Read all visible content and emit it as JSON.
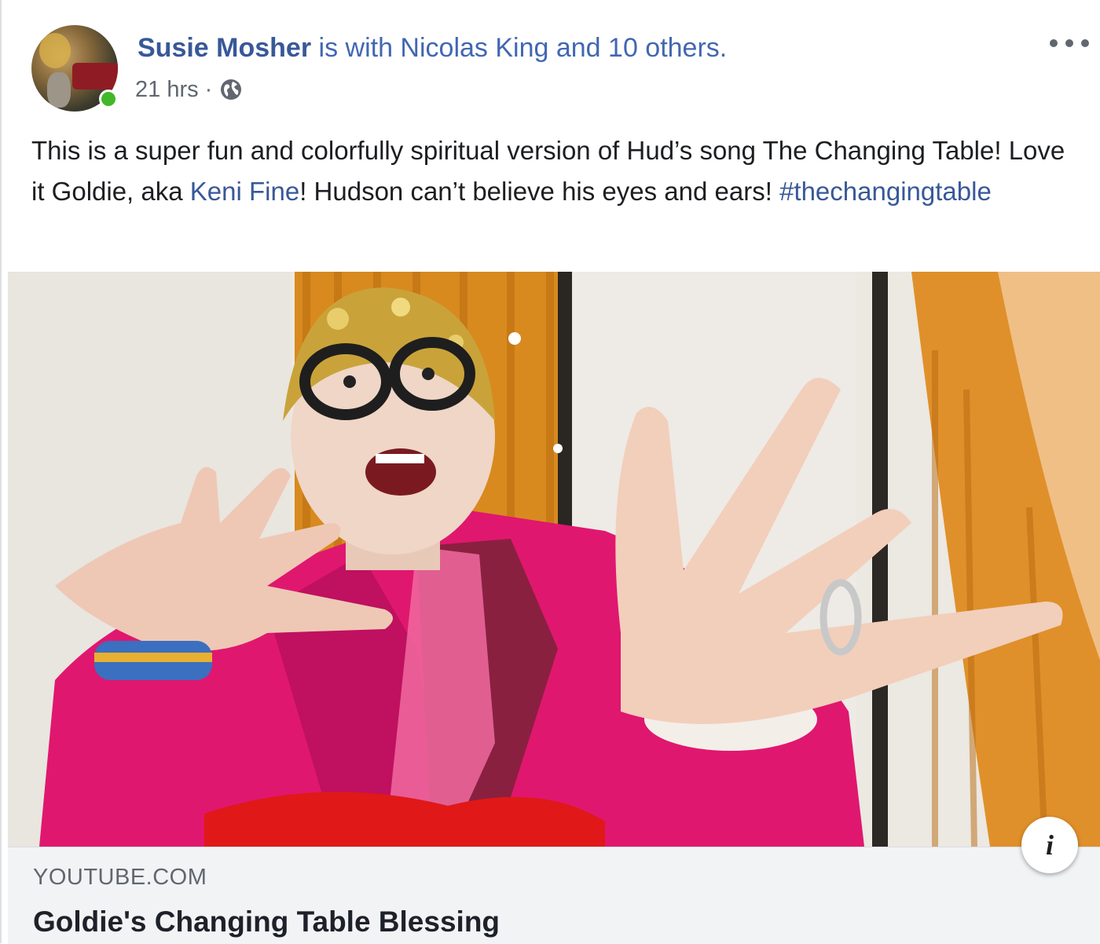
{
  "post": {
    "author_name": "Susie Mosher",
    "with_text": " is with Nicolas King and 10 others.",
    "timestamp": "21 hrs",
    "meta_separator": "·",
    "privacy_icon": "globe-icon",
    "more_icon": "more-options-icon",
    "text_part1": "This is a super fun and colorfully spiritual version of Hud’s song The Changing Table! Love it Goldie, aka ",
    "mention": "Keni Fine",
    "text_part2": "! Hudson can’t believe his eyes and ears! ",
    "hashtag": "#thechangingtable"
  },
  "link_preview": {
    "domain": "YOUTUBE.COM",
    "title": "Goldie's Changing Table Blessing",
    "info_label": "i"
  },
  "colors": {
    "link_blue": "#385898",
    "online_green": "#42b72a",
    "jacket_pink": "#e0176f",
    "curtain_orange": "#d88a1f"
  }
}
